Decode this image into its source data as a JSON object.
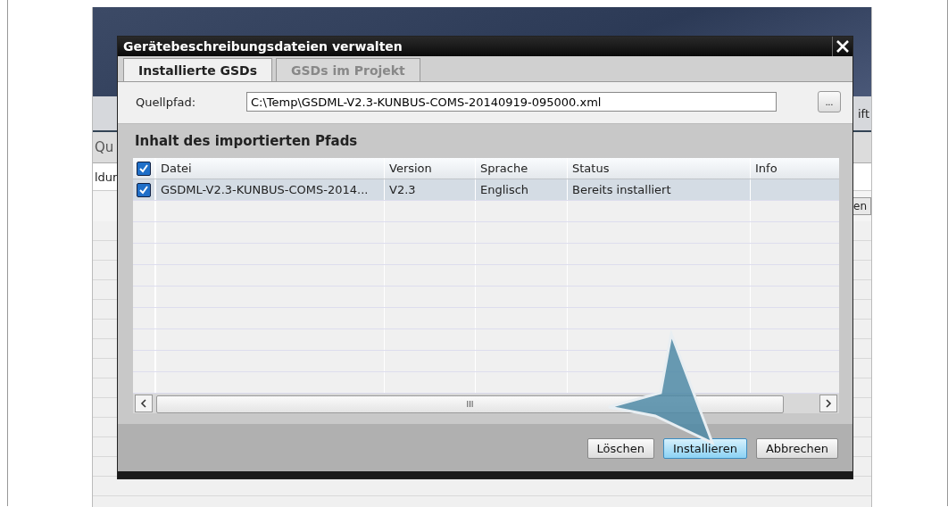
{
  "background_app": {
    "toolbar_fragment": "ift",
    "tab_fragment": "Qu",
    "column_fragment": "ldur",
    "button_fragment": "en"
  },
  "dialog": {
    "title": "Gerätebeschreibungsdateien verwalten",
    "tabs": [
      {
        "label": "Installierte GSDs",
        "selected": true
      },
      {
        "label": "GSDs im Projekt",
        "selected": false
      }
    ],
    "source_path": {
      "label": "Quellpfad:",
      "value": "C:\\Temp\\GSDML-V2.3-KUNBUS-COMS-20140919-095000.xml",
      "browse": "..."
    },
    "section_title": "Inhalt des importierten Pfads",
    "table": {
      "all_checked": true,
      "columns": [
        "Datei",
        "Version",
        "Sprache",
        "Status",
        "Info"
      ],
      "rows": [
        {
          "checked": true,
          "selected": true,
          "cells": [
            "GSDML-V2.3-KUNBUS-COMS-2014...",
            "V2.3",
            "Englisch",
            "Bereits installiert",
            ""
          ]
        }
      ]
    },
    "scrollbar_grip": "III",
    "buttons": [
      {
        "label": "Löschen",
        "highlighted": false
      },
      {
        "label": "Installieren",
        "highlighted": true
      },
      {
        "label": "Abbrechen",
        "highlighted": false
      }
    ]
  }
}
